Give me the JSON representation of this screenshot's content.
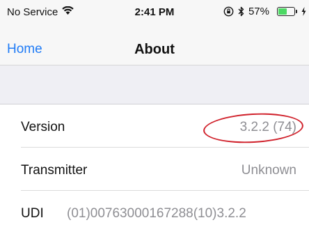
{
  "status_bar": {
    "carrier": "No Service",
    "time": "2:41 PM",
    "battery_percent": "57%",
    "battery_level": 0.57,
    "icons": [
      "wifi-icon",
      "orientation-lock-icon",
      "bluetooth-icon",
      "battery-icon",
      "charging-icon"
    ]
  },
  "nav": {
    "back_label": "Home",
    "title": "About"
  },
  "rows": [
    {
      "label": "Version",
      "value": "3.2.2 (74)"
    },
    {
      "label": "Transmitter",
      "value": "Unknown"
    },
    {
      "label": "UDI",
      "value": "(01)00763000167288(10)3.2.2"
    }
  ],
  "colors": {
    "accent": "#1f7bf6",
    "secondary_text": "#8e8e93",
    "annotation": "#d0202a",
    "battery_fill": "#4cd964"
  }
}
